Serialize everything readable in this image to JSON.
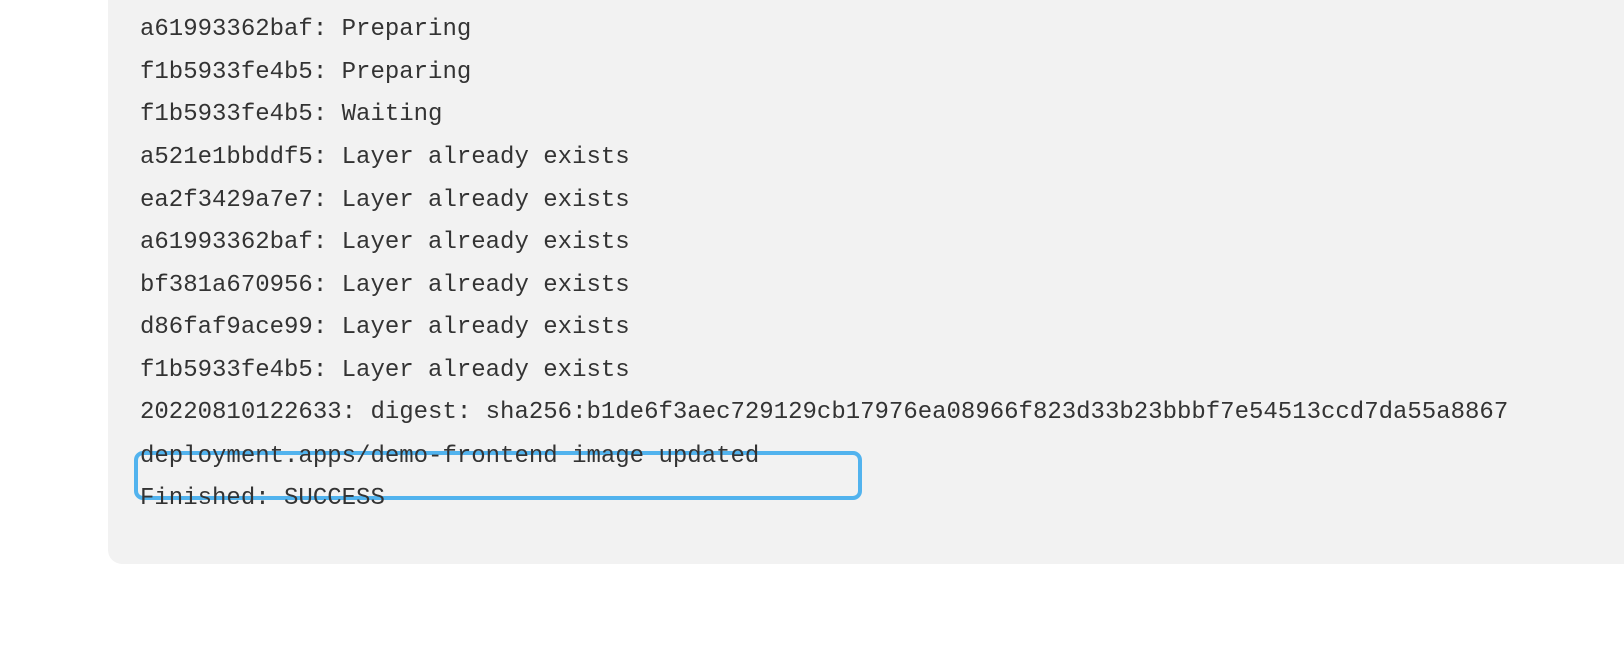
{
  "console": {
    "lines": [
      {
        "text": "a61993362baf: Preparing"
      },
      {
        "text": "f1b5933fe4b5: Preparing"
      },
      {
        "text": "f1b5933fe4b5: Waiting"
      },
      {
        "text": "a521e1bbddf5: Layer already exists"
      },
      {
        "text": "ea2f3429a7e7: Layer already exists"
      },
      {
        "text": "a61993362baf: Layer already exists"
      },
      {
        "text": "bf381a670956: Layer already exists"
      },
      {
        "text": "d86faf9ace99: Layer already exists"
      },
      {
        "text": "f1b5933fe4b5: Layer already exists"
      },
      {
        "text": "20220810122633: digest: sha256:b1de6f3aec729129cb17976ea08966f823d33b23bbbf7e54513ccd7da55a8867"
      },
      {
        "text": "deployment.apps/demo-frontend image updated",
        "highlighted": true
      },
      {
        "text": "Finished: SUCCESS"
      }
    ]
  },
  "colors": {
    "panel_background": "#f2f2f2",
    "text": "#333333",
    "highlight_border": "#52b3ee"
  }
}
